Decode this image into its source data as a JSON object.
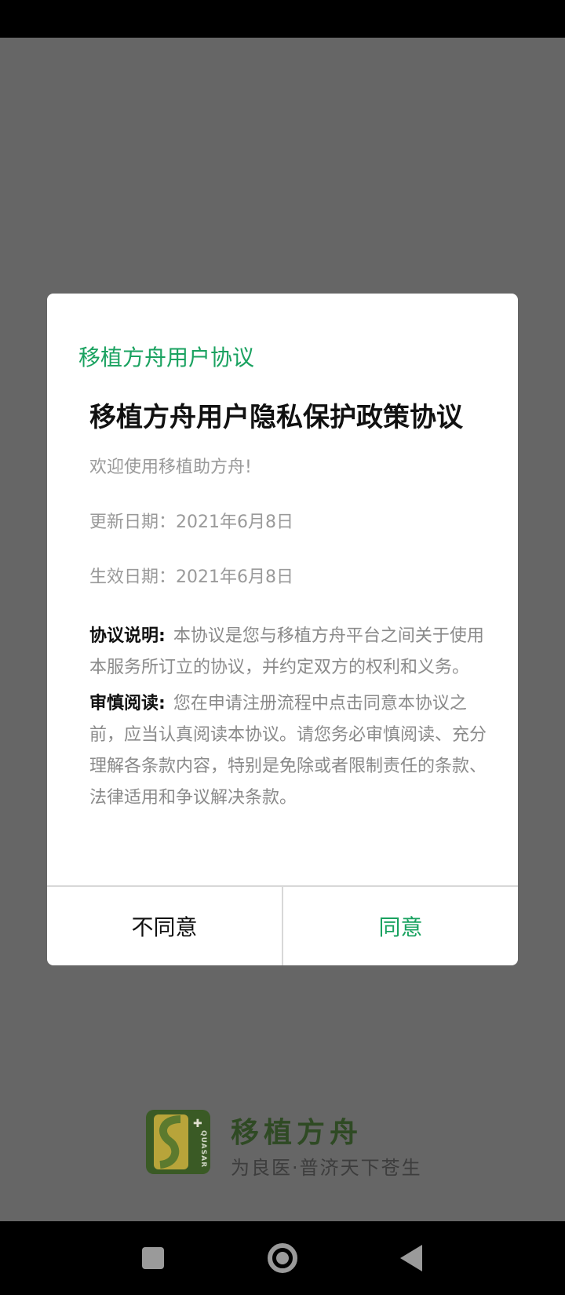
{
  "dialog": {
    "header": "移植方舟用户协议",
    "doc_title": "移植方舟用户隐私保护政策协议",
    "welcome": "欢迎使用移植助方舟!",
    "updated": "更新日期：2021年6月8日",
    "effective": "生效日期：2021年6月8日",
    "sections": [
      {
        "label": "协议说明:",
        "text": "本协议是您与移植方舟平台之间关于使用本服务所订立的协议，并约定双方的权利和义务。"
      },
      {
        "label": "审慎阅读:",
        "text": "您在申请注册流程中点击同意本协议之前，应当认真阅读本协议。请您务必审慎阅读、充分理解各条款内容，特别是免除或者限制责任的条款、法律适用和争议解决条款。"
      }
    ],
    "disagree_label": "不同意",
    "agree_label": "同意"
  },
  "brand": {
    "name": "移植方舟",
    "slogan": "为良医·普济天下苍生",
    "logo_text": "QUASAR"
  },
  "nav": {
    "icons": [
      "recents-square-icon",
      "home-circle-icon",
      "back-triangle-icon"
    ]
  },
  "colors": {
    "accent": "#1aa260",
    "overlay": "#666666"
  }
}
